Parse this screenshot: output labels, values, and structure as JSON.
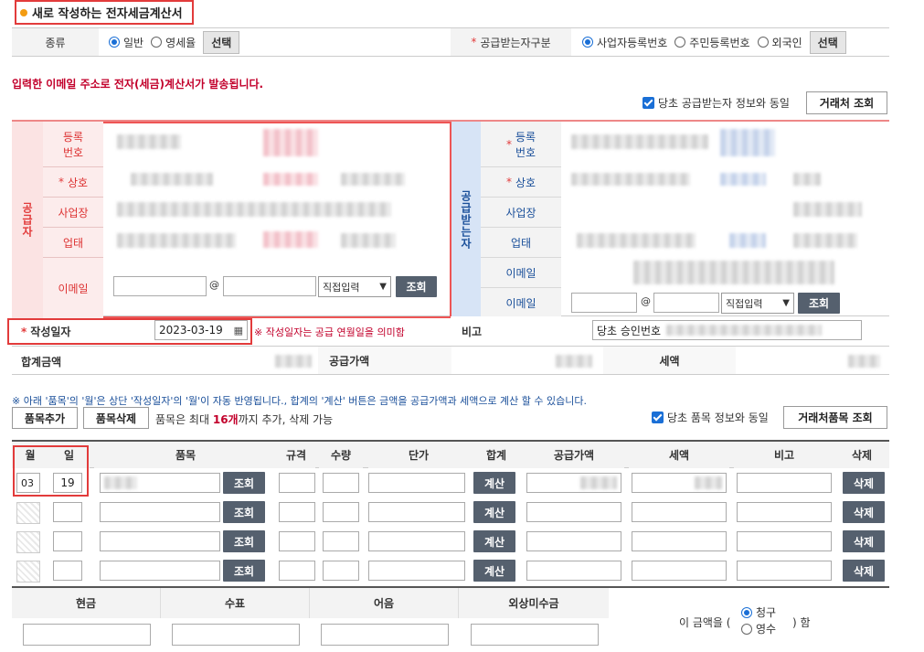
{
  "header": {
    "title": "새로 작성하는 전자세금계산서"
  },
  "type_row": {
    "label": "종류",
    "options": [
      "일반",
      "영세율"
    ],
    "selected": "일반",
    "select_btn": "선택",
    "receiver_label": "공급받는자구분",
    "receiver_options": [
      "사업자등록번호",
      "주민등록번호",
      "외국인"
    ],
    "receiver_selected": "사업자등록번호",
    "receiver_btn": "선택"
  },
  "notice": "입력한 이메일 주소로 전자(세금)계산서가 발송됩니다.",
  "same_receiver": {
    "label": "당초 공급받는자 정보와 동일",
    "btn": "거래처 조회"
  },
  "supplier": {
    "side": "공급자",
    "reg_label": "등록\n번호",
    "name_label": "상호",
    "addr_label": "사업장",
    "biz_label": "업태",
    "email_label": "이메일",
    "at": "@",
    "email_select": "직접입력",
    "lookup": "조회"
  },
  "receiver": {
    "side": "공급받는자",
    "reg_label": "등록\n번호",
    "name_label": "상호",
    "addr_label": "사업장",
    "biz_label": "업태",
    "email_label": "이메일",
    "email2_label": "이메일",
    "at": "@",
    "email_select": "직접입력",
    "lookup": "조회"
  },
  "date_row": {
    "label": "작성일자",
    "value": "2023-03-19",
    "hint": "※ 작성일자는 공급 연월일을 의미함",
    "memo_label": "비고",
    "memo_value": "당초 승인번호"
  },
  "totals": {
    "total_label": "합계금액",
    "supply_label": "공급가액",
    "tax_label": "세액"
  },
  "items_note": "※ 아래 '품목'의 '월'은 상단 '작성일자'의 '월'이 자동 반영됩니다., 합계의 '계산' 버튼은 금액을 공급가액과 세액으로 계산 할 수 있습니다.",
  "item_tools": {
    "add": "품목추가",
    "delete": "품목삭제",
    "limit_pre": "품목은 최대 ",
    "limit_num": "16개",
    "limit_post": "까지 추가, 삭제 가능",
    "same_label": "당초 품목 정보와 동일",
    "lookup_btn": "거래처품목 조회"
  },
  "item_table": {
    "headers": [
      "월",
      "일",
      "품목",
      "규격",
      "수량",
      "단가",
      "합계",
      "공급가액",
      "세액",
      "비고",
      "삭제"
    ],
    "rows": [
      {
        "month": "03",
        "day": "19"
      },
      {
        "month": "",
        "day": ""
      },
      {
        "month": "",
        "day": ""
      },
      {
        "month": "",
        "day": ""
      }
    ],
    "lookup": "조회",
    "calc": "계산",
    "delete": "삭제"
  },
  "payment": {
    "headers": [
      "현금",
      "수표",
      "어음",
      "외상미수금"
    ],
    "amount_label_pre": "이 금액을 (",
    "options": [
      "청구",
      "영수"
    ],
    "selected": "청구",
    "amount_label_post": ") 함"
  }
}
